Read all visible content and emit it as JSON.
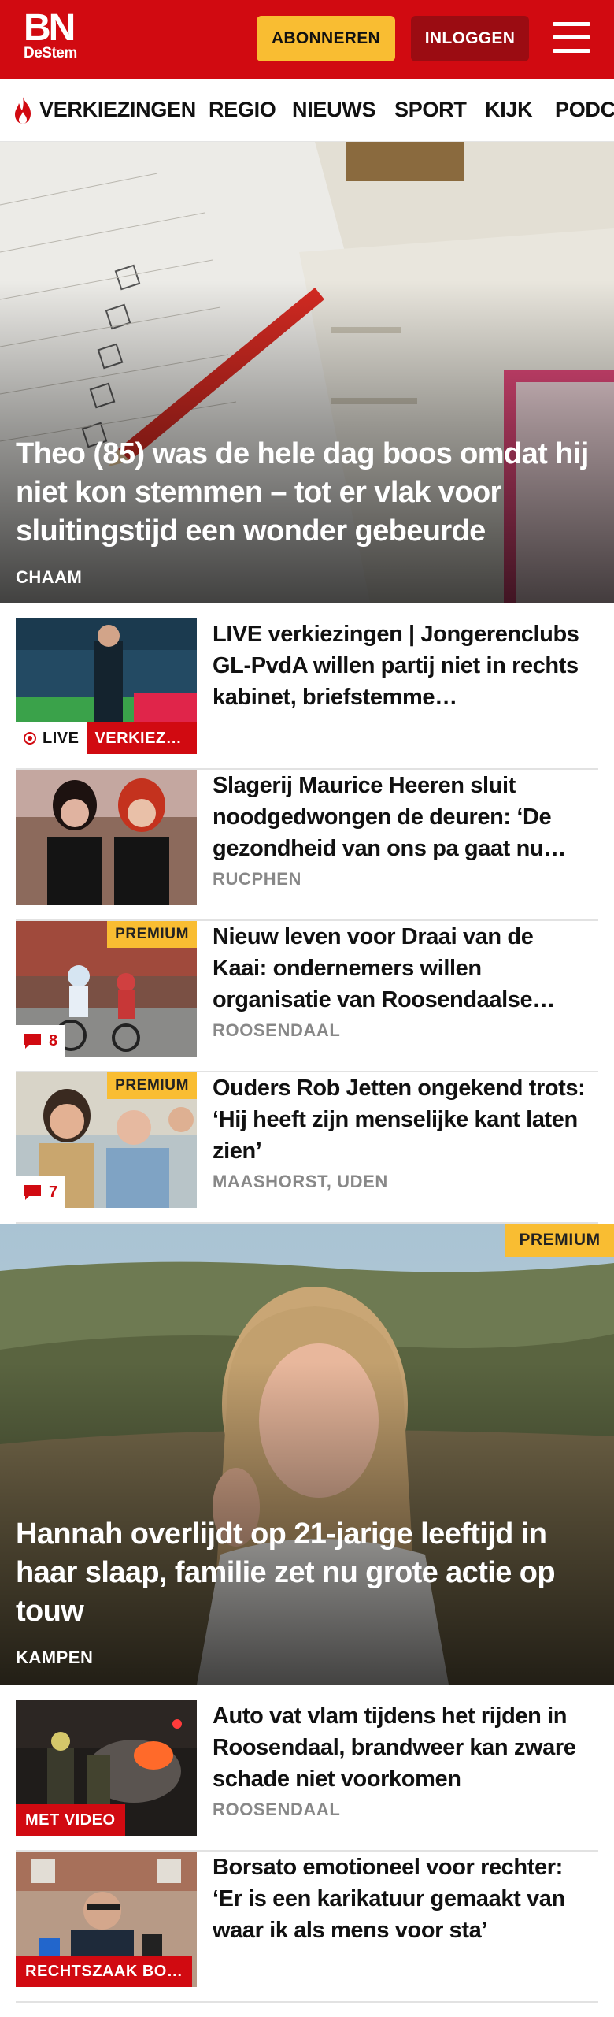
{
  "header": {
    "logo_main": "BN",
    "logo_sub": "DeStem",
    "subscribe_label": "ABONNEREN",
    "login_label": "INLOGGEN",
    "menu_icon": "hamburger-menu-icon",
    "brand_color": "#d10a11",
    "accent_color": "#f9bd32"
  },
  "nav": {
    "items": [
      {
        "label": "VERKIEZINGEN",
        "icon": "flame-icon"
      },
      {
        "label": "REGIO"
      },
      {
        "label": "NIEUWS"
      },
      {
        "label": "SPORT"
      },
      {
        "label": "KIJK"
      },
      {
        "label": "PODC"
      }
    ]
  },
  "hero1": {
    "title": "Theo (85) was de hele dag boos omdat hij niet kon stemmen – tot er vlak voor sluitingstijd een wonder gebeurde",
    "location": "CHAAM"
  },
  "articles": [
    {
      "title": "LIVE verkiezingen | Jongeren­clubs GL-PvdA willen partij niet in rechts kabinet, briefstemme…",
      "live_label": "LIVE",
      "category": "VERKIEZ…"
    },
    {
      "title": "Slagerij Maurice Heeren sluit noodgedwongen de deuren: ‘De gezondheid van ons pa gaat nu…",
      "location": "RUCPHEN"
    },
    {
      "title": "Nieuw leven voor Draai van de Kaai: ondernemers willen organisatie van Roosendaalse…",
      "location": "ROOSENDAAL",
      "badge": "PREMIUM",
      "comments": "8"
    },
    {
      "title": "Ouders Rob Jetten ongekend trots: ‘Hij heeft zijn menselijke kant laten zien’",
      "location": "MAASHORST, UDEN",
      "badge": "PREMIUM",
      "comments": "7"
    }
  ],
  "hero2": {
    "title": "Hannah overlijdt op 21-jarige leeftijd in haar slaap, familie zet nu grote actie op touw",
    "location": "KAMPEN",
    "badge": "PREMIUM"
  },
  "articles2": [
    {
      "title": "Auto vat vlam tijdens het rijden in Roosendaal, brandweer kan zware schade niet voorkomen",
      "location": "ROOSENDAAL",
      "tag": "MET VIDEO"
    },
    {
      "title": "Borsato emotioneel voor rechter: ‘Er is een karikatuur gemaakt van waar ik als mens voor sta’",
      "tag": "RECHTSZAAK BO…"
    }
  ]
}
